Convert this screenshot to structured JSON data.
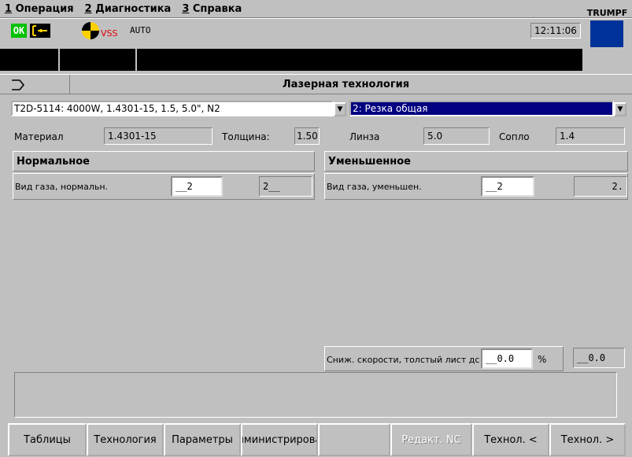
{
  "menu": {
    "items": [
      {
        "key": "1",
        "label": "Операция"
      },
      {
        "key": "2",
        "label": "Диагностика"
      },
      {
        "key": "3",
        "label": "Справка"
      }
    ]
  },
  "status": {
    "ok_label": "OK",
    "vss_label": "VSS",
    "mode_label": "AUTO",
    "clock": "12:11:06",
    "logo_text": "TRUMPF",
    "colors": {
      "ok": "#00c000",
      "vss": "#e00000",
      "logo_box": "#003399",
      "selection": "#000080"
    }
  },
  "header": {
    "nav_icon": "forward-arrow-icon",
    "title": "Лазерная технология"
  },
  "selectors": {
    "technology_table": "T2D-5114:  4000W,  1.4301-15,  1.5,  5.0\", N2",
    "cut_type": "2:  Резка общая"
  },
  "info": {
    "material_label": "Материал",
    "material_value": "1.4301-15",
    "thickness_label": "Толщина:",
    "thickness_value": "1.50",
    "lens_label": "Линза",
    "lens_value": "5.0",
    "nozzle_label": "Сопло",
    "nozzle_value": "1.4"
  },
  "normal_panel": {
    "title": "Нормальное",
    "gas_label": "Вид газа, нормальн.",
    "gas_input": "__2",
    "gas_value": "2__"
  },
  "reduced_panel": {
    "title": "Уменьшенное",
    "gas_label": "Вид газа, уменьшен.",
    "gas_input": "__2",
    "gas_value": "2."
  },
  "speed_reduction": {
    "label": "Сниж. скорости, толстый лист дс",
    "input": "__0.0",
    "unit": "%",
    "value": "__0.0"
  },
  "buttons": [
    {
      "label": "Таблицы",
      "enabled": true
    },
    {
      "label": "Технология",
      "enabled": true
    },
    {
      "label": "Параметры",
      "enabled": true
    },
    {
      "label": "лминистрирова",
      "enabled": true
    },
    {
      "label": "",
      "enabled": true
    },
    {
      "label": "Редакт. NC",
      "enabled": false
    },
    {
      "label": "Технол. <",
      "enabled": true
    },
    {
      "label": "Технол. >",
      "enabled": true
    }
  ]
}
